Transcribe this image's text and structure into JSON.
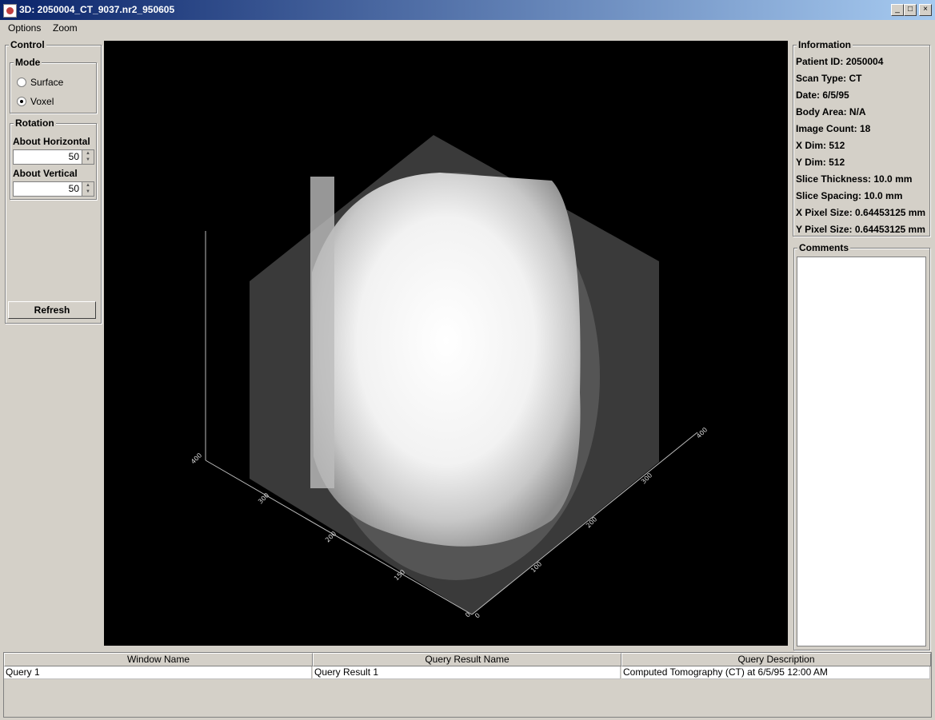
{
  "window": {
    "title": "3D: 2050004_CT_9037.nr2_950605",
    "controls": {
      "minimize": "_",
      "maximize": "□",
      "close": "×"
    }
  },
  "menu": {
    "items": [
      "Options",
      "Zoom"
    ]
  },
  "control_panel": {
    "title": "Control",
    "mode": {
      "title": "Mode",
      "options": [
        {
          "label": "Surface",
          "selected": false
        },
        {
          "label": "Voxel",
          "selected": true
        }
      ]
    },
    "rotation": {
      "title": "Rotation",
      "horizontal_label": "About Horizontal",
      "horizontal_value": "50",
      "vertical_label": "About Vertical",
      "vertical_value": "50"
    },
    "refresh_label": "Refresh"
  },
  "viewport": {
    "axis_ticks_left": [
      "400"
    ],
    "axis_ticks_front": [
      "300",
      "200",
      "150",
      "0"
    ],
    "axis_ticks_right": [
      "400",
      "300",
      "200",
      "100",
      "0"
    ]
  },
  "information": {
    "title": "Information",
    "rows": [
      "Patient ID: 2050004",
      "Scan Type: CT",
      "Date: 6/5/95",
      "Body Area: N/A",
      "Image Count: 18",
      "X Dim: 512",
      "Y Dim: 512",
      "Slice Thickness: 10.0 mm",
      "Slice Spacing: 10.0 mm",
      "X Pixel Size: 0.64453125 mm",
      "Y Pixel Size: 0.64453125 mm"
    ]
  },
  "comments": {
    "title": "Comments",
    "text": ""
  },
  "results_table": {
    "headers": [
      "Window Name",
      "Query Result Name",
      "Query Description"
    ],
    "rows": [
      [
        "Query 1",
        "Query Result 1",
        "Computed Tomography (CT) at 6/5/95 12:00 AM"
      ]
    ]
  }
}
